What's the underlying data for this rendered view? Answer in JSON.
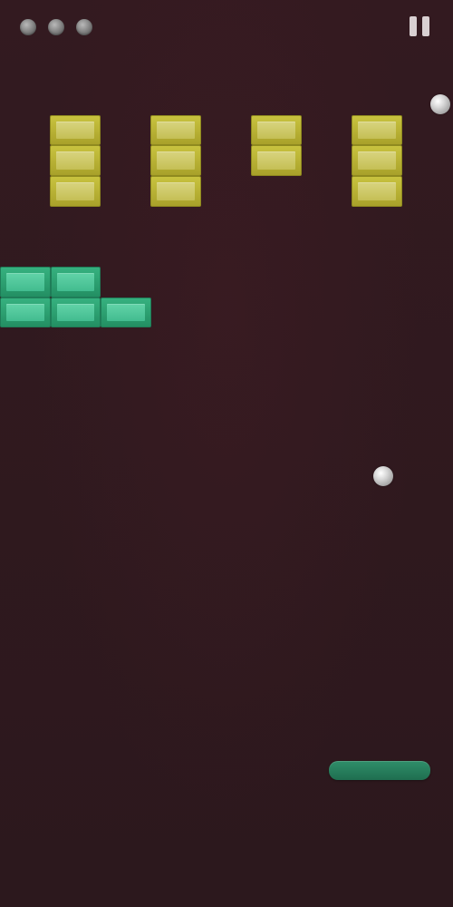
{
  "hud": {
    "lives_remaining": 3,
    "life_icon": "ball-icon",
    "pause_icon": "pause-icon"
  },
  "game": {
    "brick_colors": {
      "yellow": "#c9c33f",
      "green": "#36b17f"
    },
    "balls_in_play": 2,
    "paddle_color": "#2f8e6a",
    "background_color": "#2f1a1f"
  }
}
